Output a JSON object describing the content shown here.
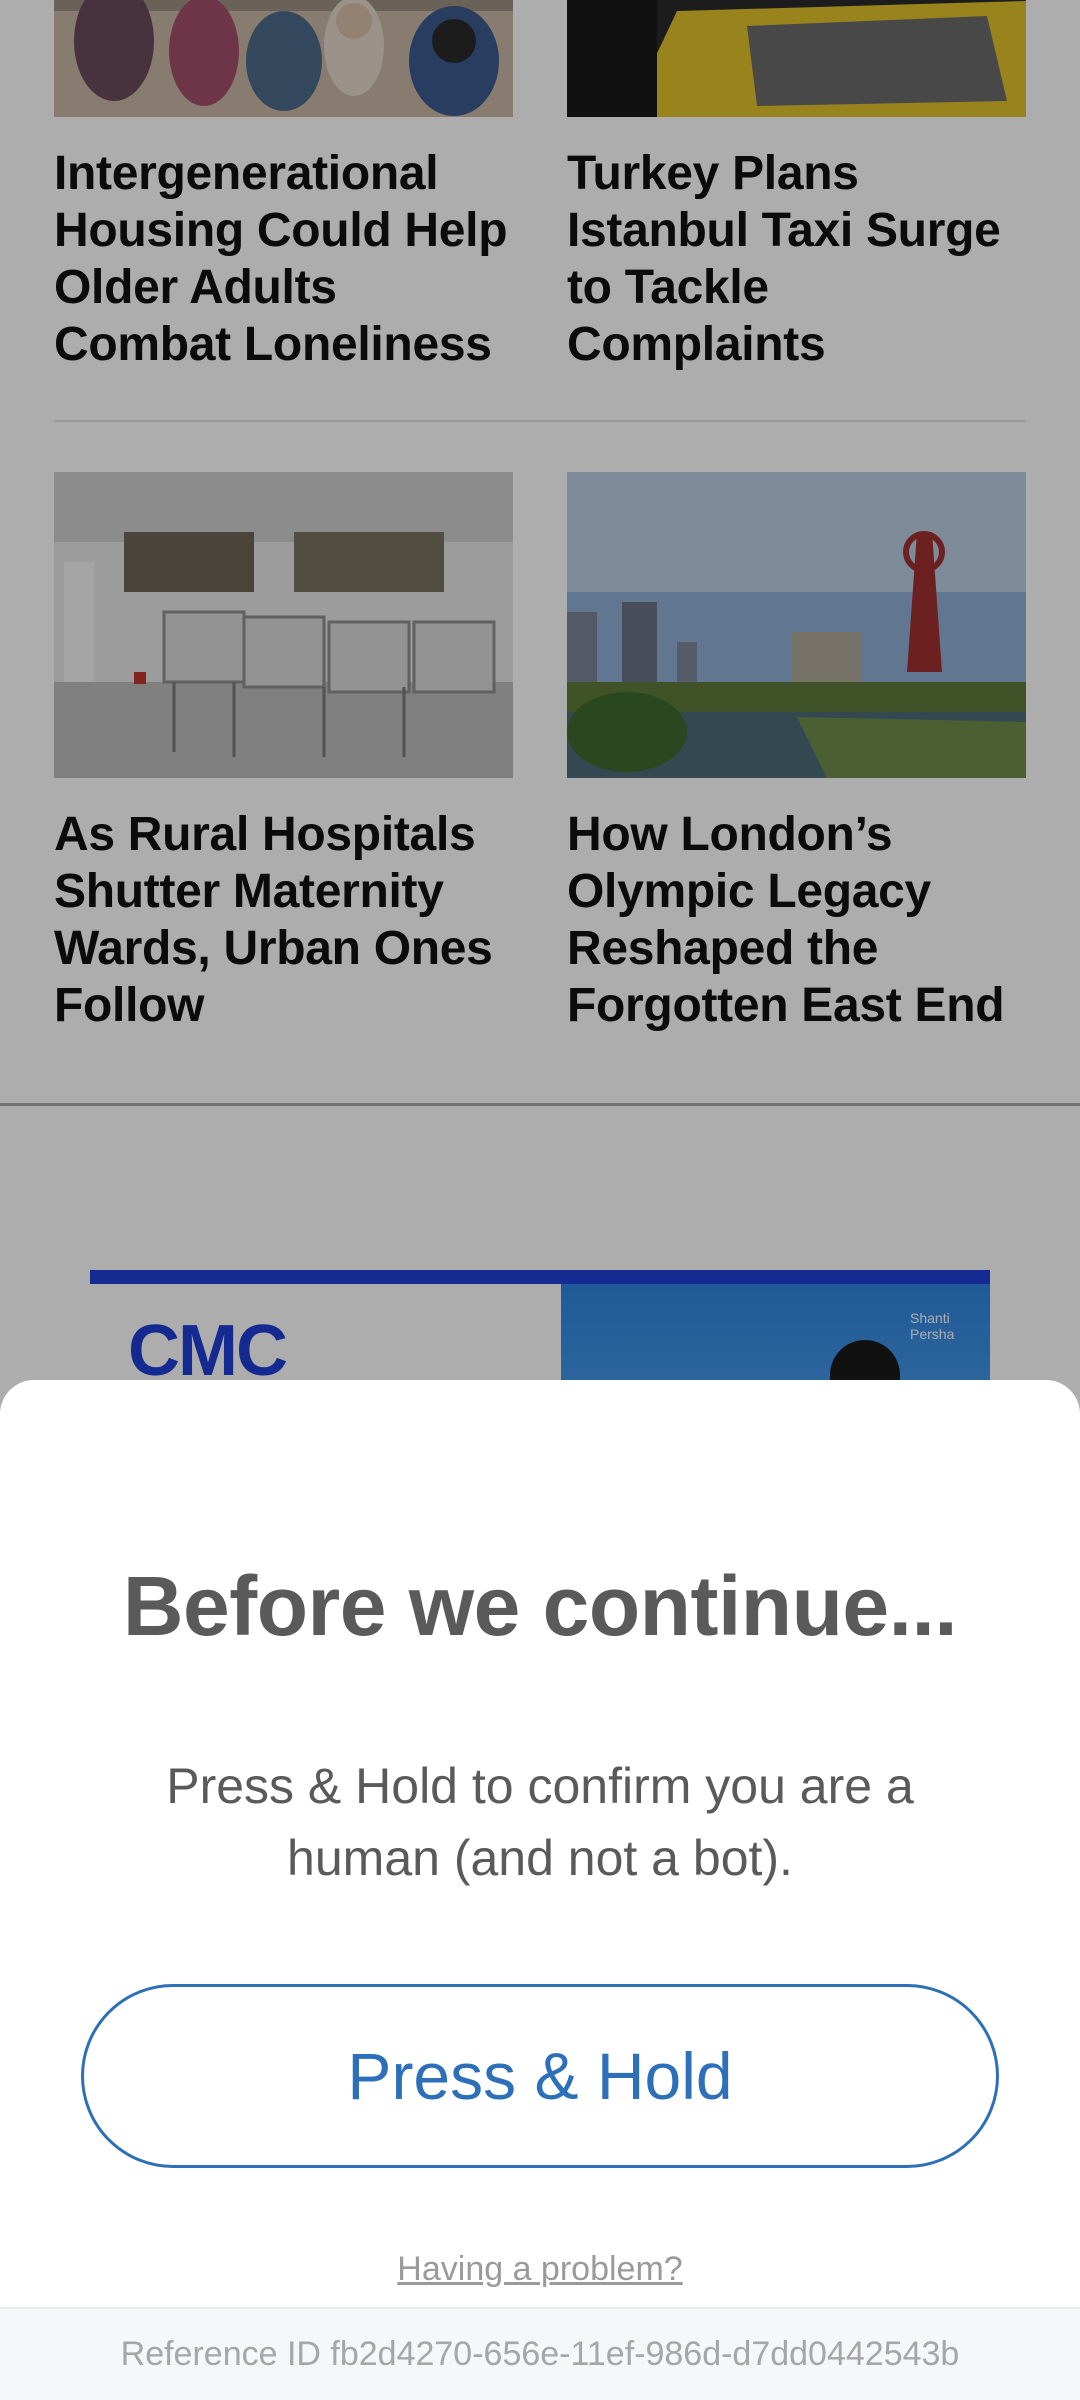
{
  "articles": [
    {
      "headline": "Intergenerational Housing Could Help Older Adults Combat Loneliness",
      "image": "children-in-classroom-photo"
    },
    {
      "headline": "Turkey Plans Istanbul Taxi Surge to Tackle Complaints",
      "image": "yellow-taxi-photo"
    },
    {
      "headline": "As Rural Hospitals Shutter Maternity Wards, Urban Ones Follow",
      "image": "hospital-bassinets-photo"
    },
    {
      "headline": "How London’s Olympic Legacy Reshaped the Forgotten East End",
      "image": "olympic-park-river-photo"
    }
  ],
  "ad": {
    "logo": "CMC",
    "photo_caption": "Shanti Persha",
    "brand_color": "#1f3fd6"
  },
  "challenge": {
    "title": "Before we continue...",
    "description": "Press & Hold to confirm you are a human (and not a bot).",
    "button_label": "Press & Hold",
    "problem_link": "Having a problem?",
    "reference": "Reference ID fb2d4270-656e-11ef-986d-d7dd0442543b",
    "accent_color": "#2d6fb8"
  }
}
